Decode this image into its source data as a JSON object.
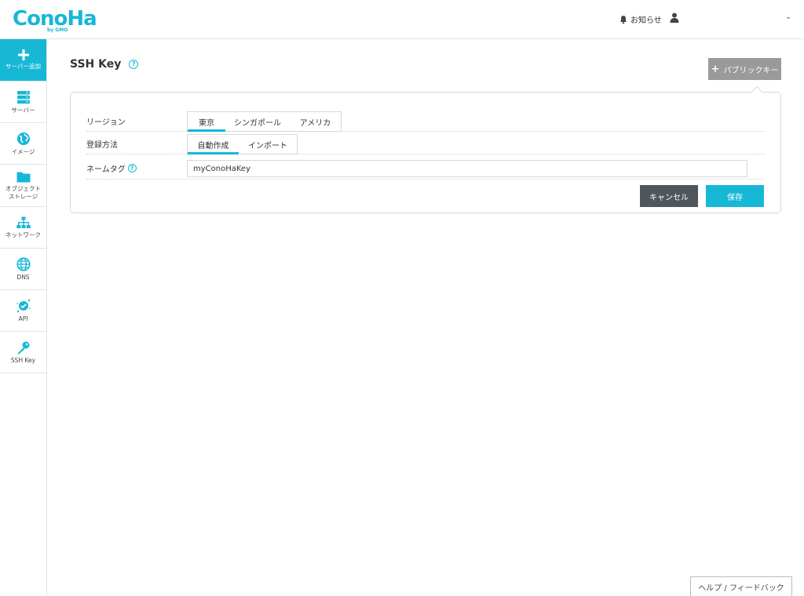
{
  "brand": {
    "logo_text": "ConoHa",
    "logo_sub": "by GMO",
    "accent": "#17b7d6"
  },
  "header": {
    "notice_label": "お知らせ",
    "icons": [
      "bell-icon",
      "user-icon",
      "chevron-down-icon"
    ]
  },
  "sidebar": {
    "items": [
      {
        "label": "サーバー追加",
        "icon": "plus-icon"
      },
      {
        "label": "サーバー",
        "icon": "server-icon"
      },
      {
        "label": "イメージ",
        "icon": "image-icon"
      },
      {
        "label_line1": "オブジェクト",
        "label_line2": "ストレージ",
        "icon": "folder-icon"
      },
      {
        "label": "ネットワーク",
        "icon": "network-icon"
      },
      {
        "label": "DNS",
        "icon": "globe-icon"
      },
      {
        "label": "API",
        "icon": "api-icon"
      },
      {
        "label": "SSH Key",
        "icon": "key-icon"
      }
    ]
  },
  "page": {
    "title": "SSH Key",
    "help_symbol": "?",
    "public_key_button": "パブリックキー"
  },
  "form": {
    "region": {
      "label": "リージョン",
      "options": [
        "東京",
        "シンガポール",
        "アメリカ"
      ],
      "selected": "東京"
    },
    "method": {
      "label": "登録方法",
      "options": [
        "自動作成",
        "インポート"
      ],
      "selected": "自動作成"
    },
    "name_tag": {
      "label": "ネームタグ",
      "value": "myConoHaKey"
    },
    "cancel_label": "キャンセル",
    "save_label": "保存"
  },
  "footer": {
    "feedback_label": "ヘルプ / フィードバック"
  }
}
